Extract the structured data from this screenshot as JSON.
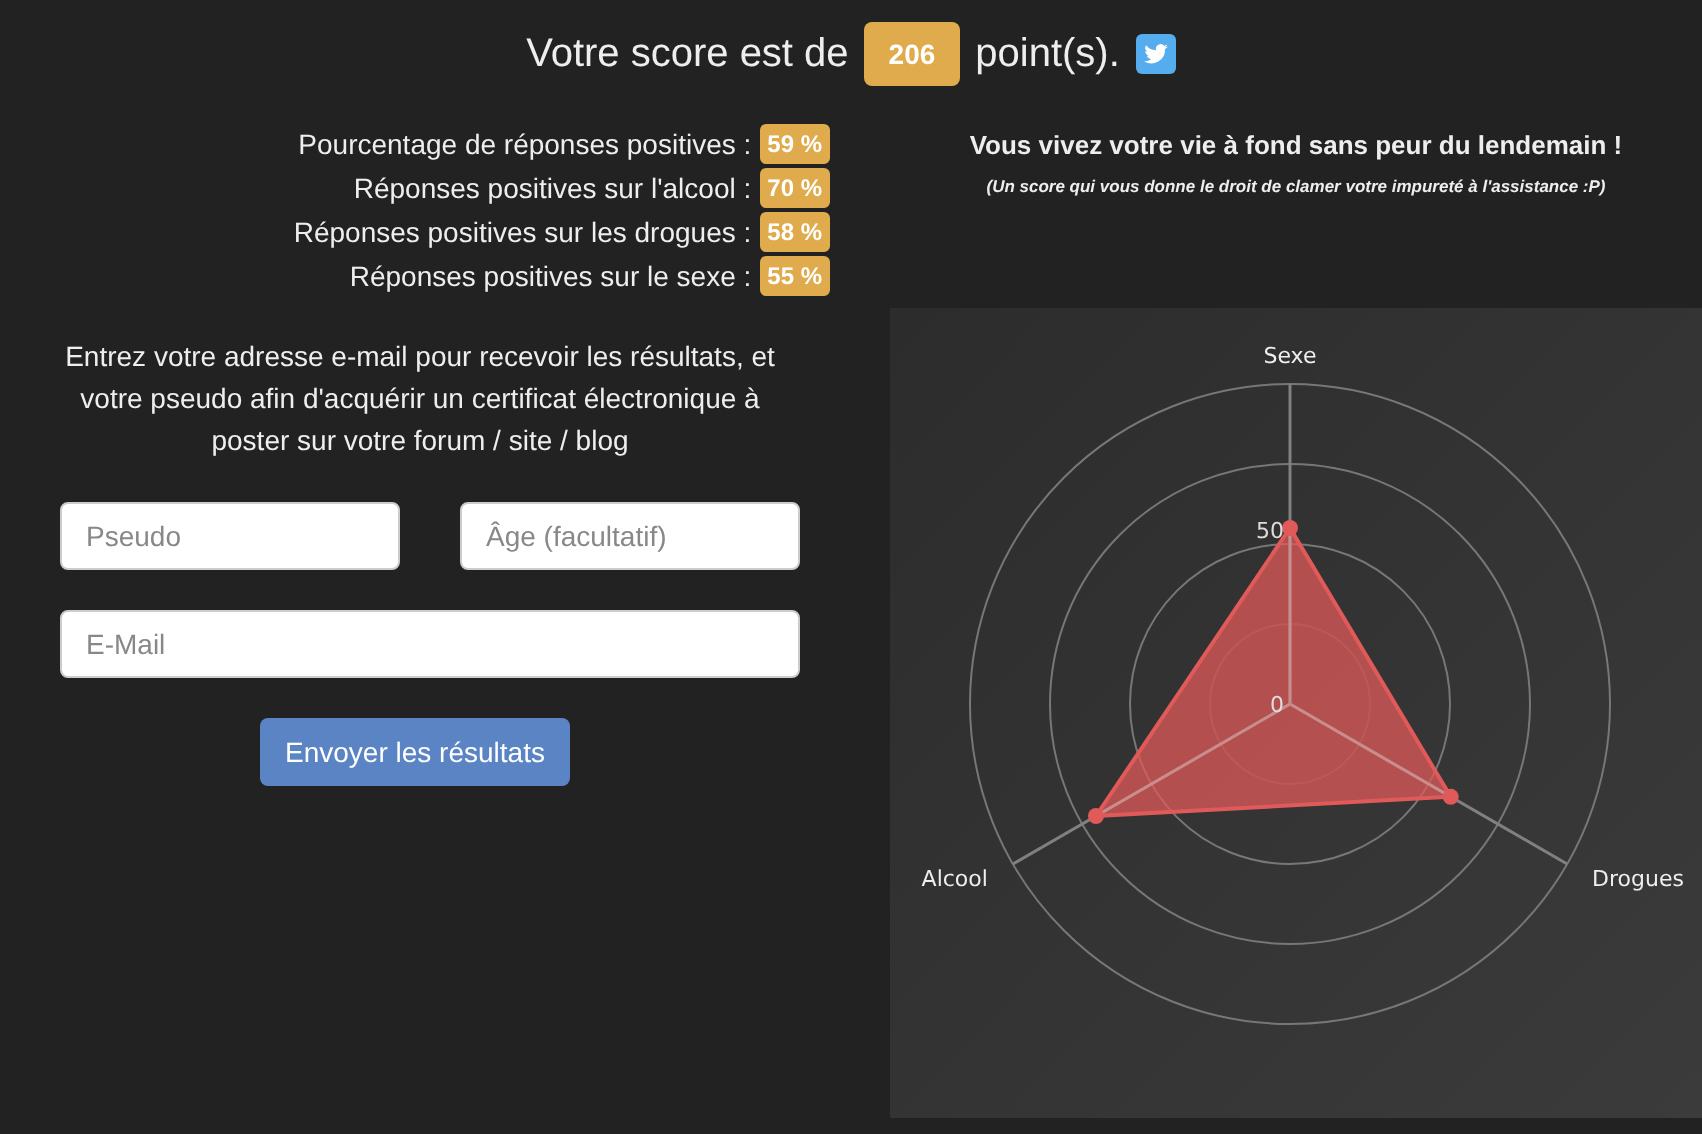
{
  "header": {
    "prefix": "Votre score est de",
    "score": "206",
    "suffix": "point(s)."
  },
  "stats": [
    {
      "label": "Pourcentage de réponses positives :",
      "value": "59 %"
    },
    {
      "label": "Réponses positives sur l'alcool :",
      "value": "70 %"
    },
    {
      "label": "Réponses positives sur les drogues :",
      "value": "58 %"
    },
    {
      "label": "Réponses positives sur le sexe :",
      "value": "55 %"
    }
  ],
  "verdict": {
    "title": "Vous vivez votre vie à fond sans peur du lendemain !",
    "subtitle": "(Un score qui vous donne le droit de clamer votre impureté à l'assistance :P)"
  },
  "form": {
    "intro": "Entrez votre adresse e-mail pour recevoir les résultats, et votre pseudo afin d'acquérir un certificat électronique à poster sur votre forum / site / blog",
    "fields": [
      {
        "placeholder": "Pseudo"
      },
      {
        "placeholder": "Âge (facultatif)"
      },
      {
        "placeholder": "E-Mail"
      }
    ],
    "submit": "Envoyer les résultats"
  },
  "radar": {
    "axes": [
      {
        "label": "Sexe",
        "level": 0.55
      },
      {
        "label": "Drogues",
        "level": 0.58
      },
      {
        "label": "Alcool",
        "level": 0.7
      }
    ],
    "tick_labels": [
      "50",
      "0"
    ]
  }
}
